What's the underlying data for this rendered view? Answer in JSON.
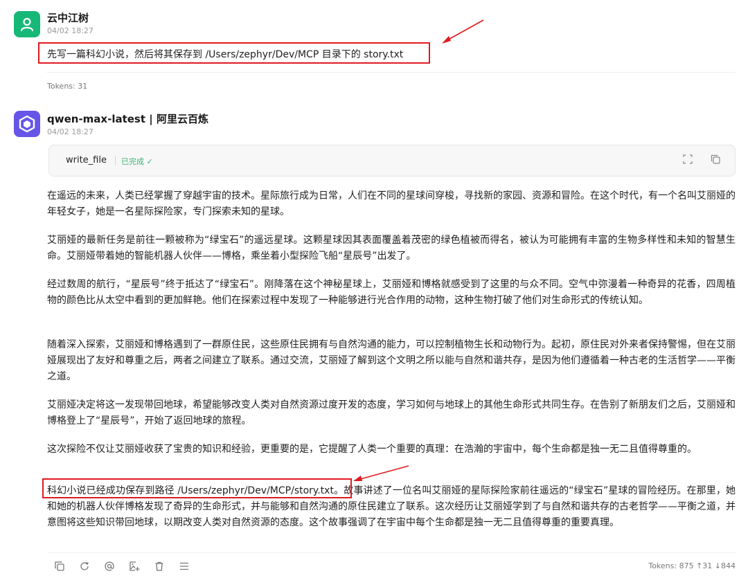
{
  "user_message": {
    "name": "云中江树",
    "time": "04/02 18:27",
    "text": "先写一篇科幻小说，然后将其保存到 /Users/zephyr/Dev/MCP 目录下的 story.txt",
    "tokens": "Tokens: 31"
  },
  "assistant_message": {
    "name": "qwen-max-latest | 阿里云百炼",
    "time": "04/02 18:27",
    "tool_call": {
      "name": "write_file",
      "status": "已完成 ✓"
    },
    "paragraphs": [
      "在遥远的未来，人类已经掌握了穿越宇宙的技术。星际旅行成为日常，人们在不同的星球间穿梭，寻找新的家园、资源和冒险。在这个时代，有一个名叫艾丽娅的年轻女子，她是一名星际探险家，专门探索未知的星球。",
      "艾丽娅的最新任务是前往一颗被称为“绿宝石”的遥远星球。这颗星球因其表面覆盖着茂密的绿色植被而得名，被认为可能拥有丰富的生物多样性和未知的智慧生命。艾丽娅带着她的智能机器人伙伴——博格，乘坐着小型探险飞船“星辰号”出发了。",
      "经过数周的航行，“星辰号”终于抵达了“绿宝石”。刚降落在这个神秘星球上，艾丽娅和博格就感受到了这里的与众不同。空气中弥漫着一种奇异的花香，四周植物的颜色比从太空中看到的更加鲜艳。他们在探索过程中发现了一种能够进行光合作用的动物，这种生物打破了他们对生命形式的传统认知。",
      "随着深入探索，艾丽娅和博格遇到了一群原住民，这些原住民拥有与自然沟通的能力，可以控制植物生长和动物行为。起初，原住民对外来者保持警惕，但在艾丽娅展现出了友好和尊重之后，两者之间建立了联系。通过交流，艾丽娅了解到这个文明之所以能与自然和谐共存，是因为他们遵循着一种古老的生活哲学——平衡之道。",
      "艾丽娅决定将这一发现带回地球，希望能够改变人类对自然资源过度开发的态度，学习如何与地球上的其他生命形式共同生存。在告别了新朋友们之后，艾丽娅和博格登上了“星辰号”，开始了返回地球的旅程。",
      "这次探险不仅让艾丽娅收获了宝贵的知识和经验，更重要的是，它提醒了人类一个重要的真理：在浩瀚的宇宙中，每个生命都是独一无二且值得尊重的。"
    ],
    "final_highlight": "科幻小说已经成功保存到路径 /Users/zephyr/Dev/MCP/story.txt。",
    "final_rest": "故事讲述了一位名叫艾丽娅的星际探险家前往遥远的“绿宝石”星球的冒险经历。在那里，她和她的机器人伙伴博格发现了奇异的生命形式，并与能够和自然沟通的原住民建立了联系。这次经历让艾丽娅学到了与自然和谐共存的古老哲学——平衡之道，并意图将这些知识带回地球，以期改变人类对自然资源的态度。这个故事强调了在宇宙中每个生命都是独一无二且值得尊重的重要真理。",
    "tokens": "Tokens: 875 ↑31 ↓844"
  },
  "icons": {
    "user_avatar": "person-icon",
    "bot_avatar": "qwen-logo-icon",
    "expand": "expand-icon",
    "copy": "copy-icon",
    "actions": [
      "copy-icon",
      "refresh-icon",
      "mention-icon",
      "image-add-icon",
      "trash-icon",
      "menu-icon"
    ]
  },
  "colors": {
    "annotation_red": "#e0191f",
    "status_green": "#3bb36f",
    "user_avatar_bg": "#16b878",
    "bot_avatar_bg": "#6556e8"
  }
}
